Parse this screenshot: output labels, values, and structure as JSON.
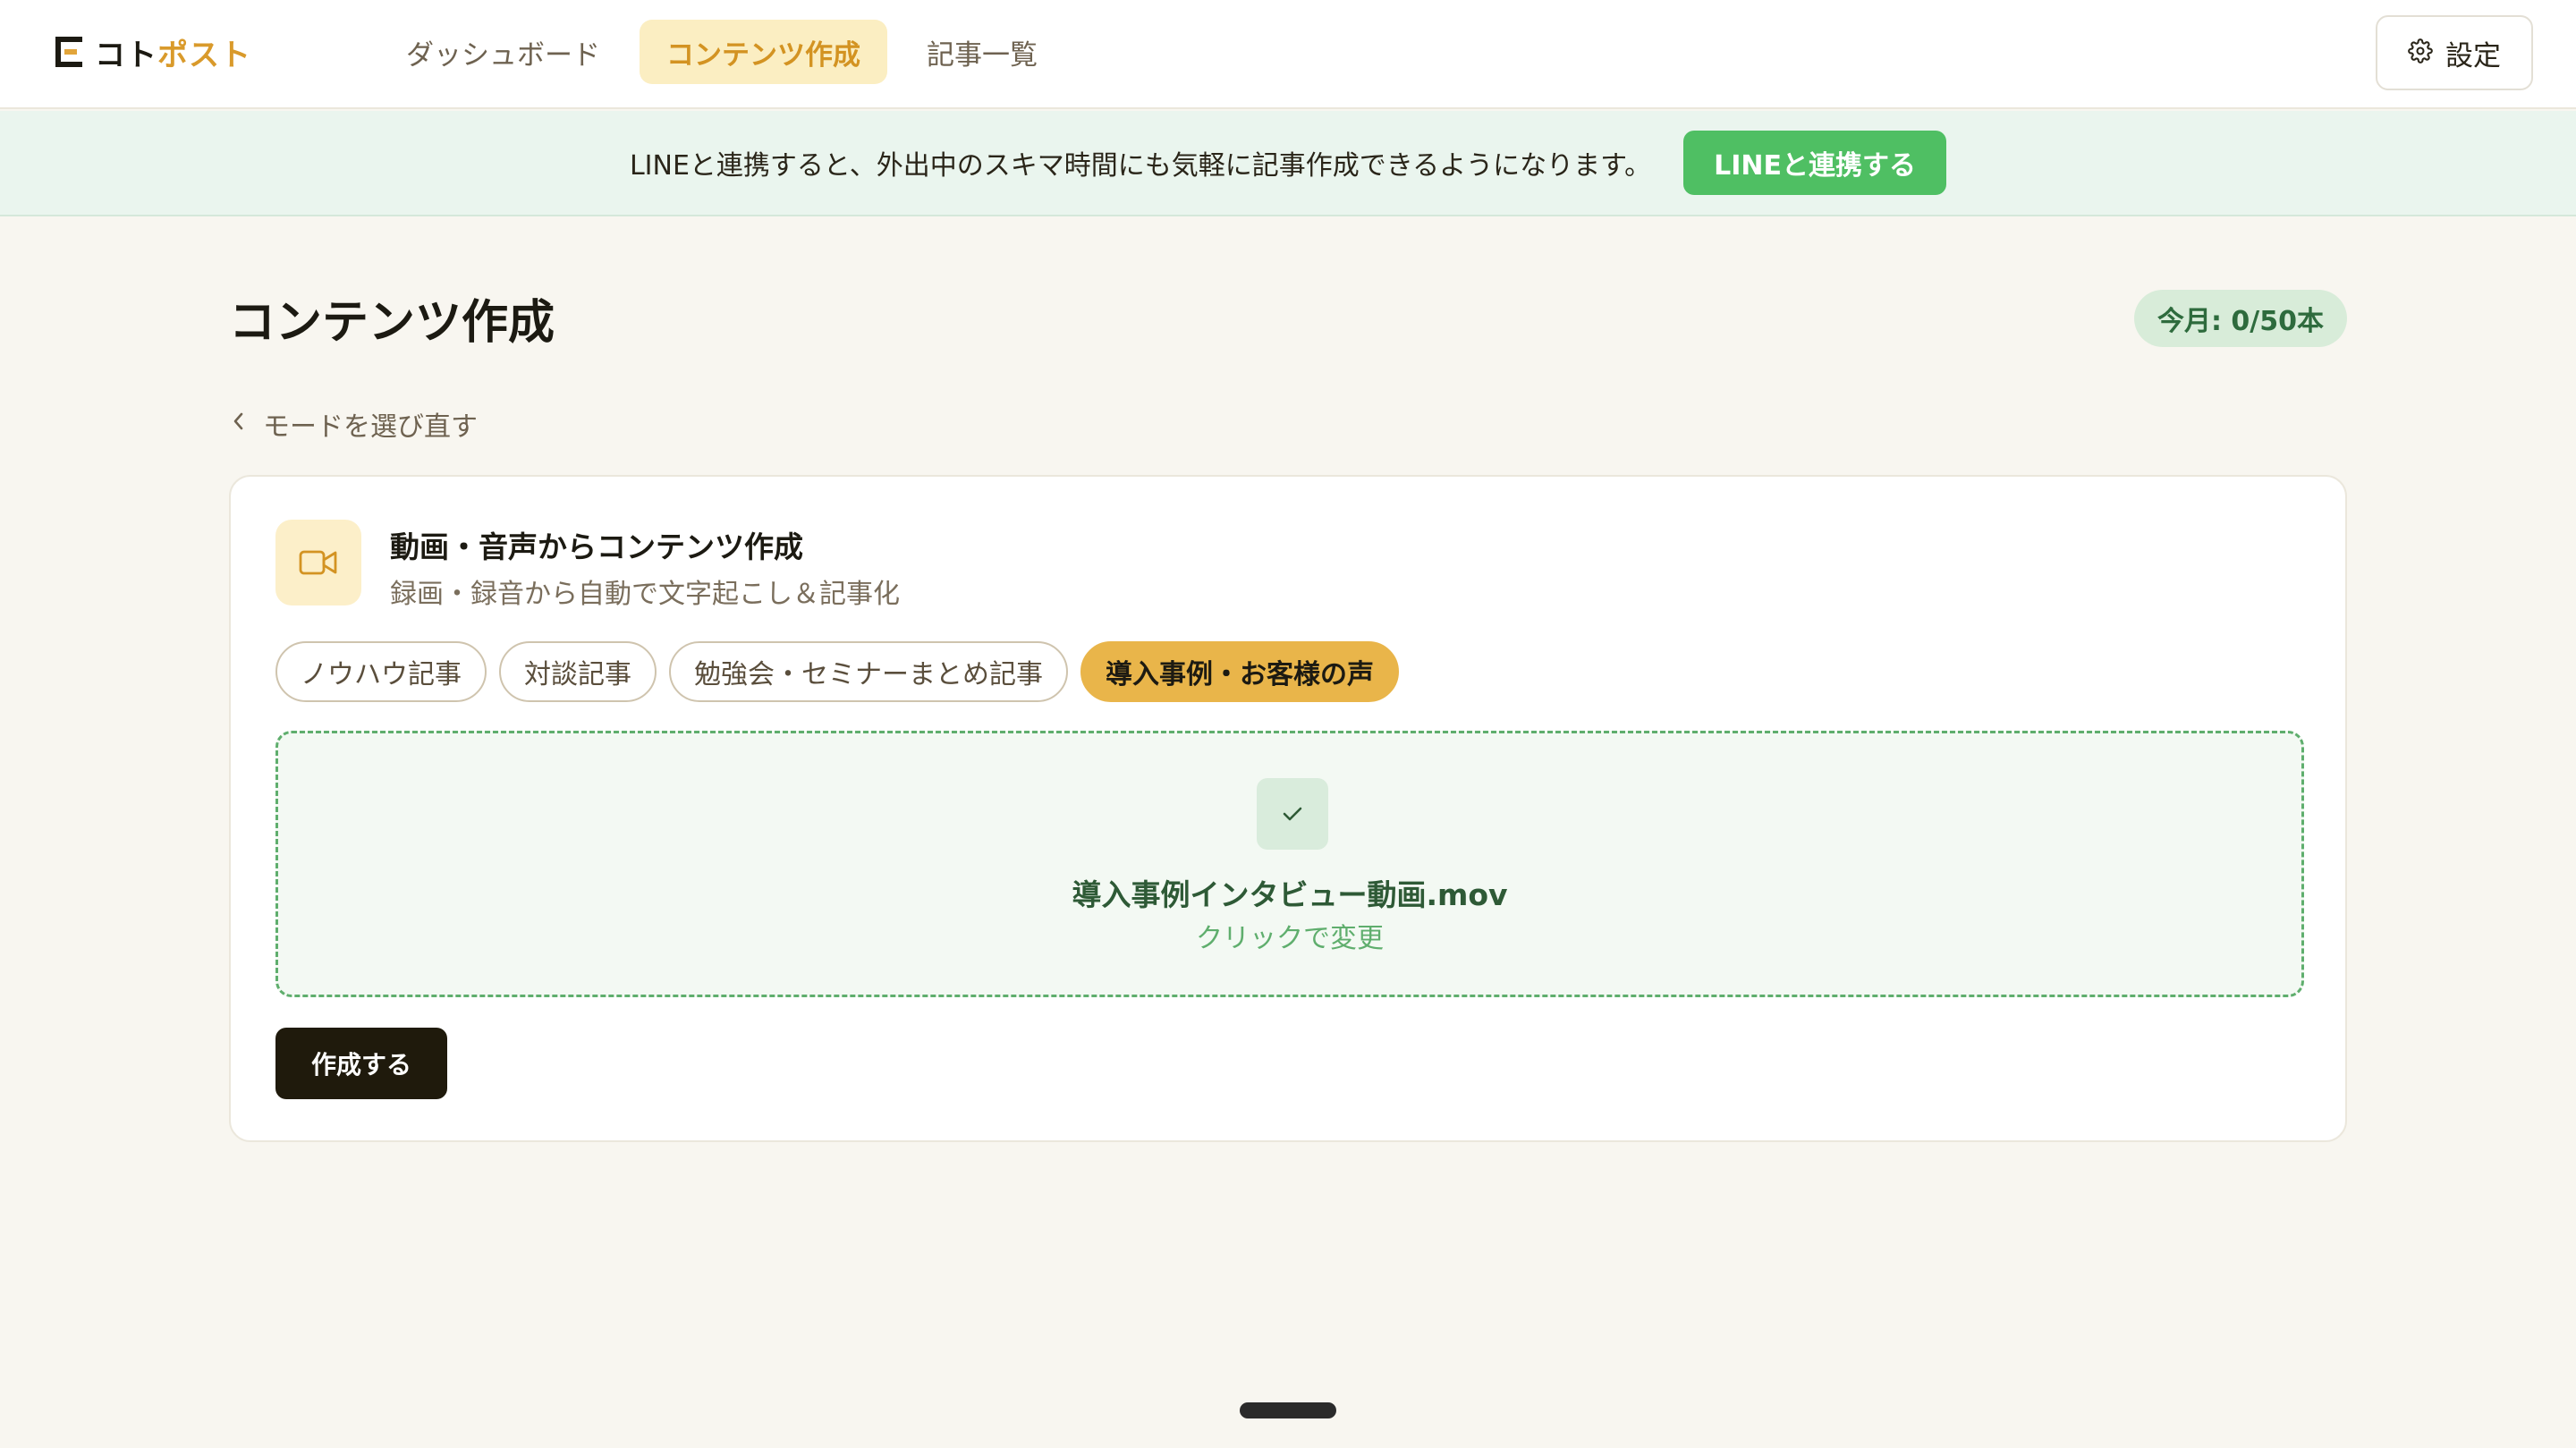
{
  "logo": {
    "text_a": "コト",
    "text_b": "ポスト"
  },
  "nav": {
    "tabs": [
      {
        "label": "ダッシュボード",
        "active": false
      },
      {
        "label": "コンテンツ作成",
        "active": true
      },
      {
        "label": "記事一覧",
        "active": false
      }
    ]
  },
  "header": {
    "settings_label": "設定"
  },
  "banner": {
    "text": "LINEと連携すると、外出中のスキマ時間にも気軽に記事作成できるようになります。",
    "button_label": "LINEと連携する"
  },
  "main": {
    "title": "コンテンツ作成",
    "quota": "今月: 0/50本",
    "back_label": "モードを選び直す"
  },
  "card": {
    "mode_title": "動画・音声からコンテンツ作成",
    "mode_subtitle": "録画・録音から自動で文字起こし＆記事化",
    "mode_icon": "video-camera-icon",
    "pills": [
      {
        "label": "ノウハウ記事",
        "active": false
      },
      {
        "label": "対談記事",
        "active": false
      },
      {
        "label": "勉強会・セミナーまとめ記事",
        "active": false
      },
      {
        "label": "導入事例・お客様の声",
        "active": true
      }
    ],
    "upload": {
      "file_name": "導入事例インタビュー動画.mov",
      "change_hint": "クリックで変更"
    },
    "create_label": "作成する"
  },
  "colors": {
    "accent": "#e9b54a",
    "line_green": "#4fbf63",
    "dark_button": "#1f1a0c",
    "background": "#f8f6f0"
  }
}
